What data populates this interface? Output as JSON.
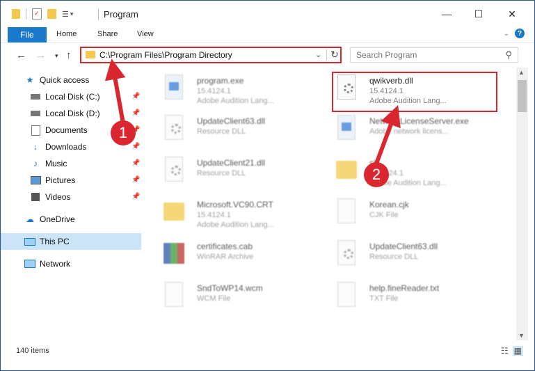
{
  "window": {
    "title": "Program",
    "controls": {
      "minimize": "—",
      "maximize": "☐",
      "close": "✕"
    }
  },
  "ribbon": {
    "tabs": [
      "File",
      "Home",
      "Share",
      "View"
    ],
    "help": "?"
  },
  "address": {
    "path": "C:\\Program Files\\Program Directory",
    "search_placeholder": "Search Program"
  },
  "nav": {
    "items": [
      {
        "label": "Quick access",
        "icon": "star-icon",
        "color": "#1979ca"
      },
      {
        "label": "Local Disk (C:)",
        "icon": "drive-icon",
        "pinned": true
      },
      {
        "label": "Local Disk (D:)",
        "icon": "drive-icon",
        "pinned": true
      },
      {
        "label": "Documents",
        "icon": "documents-icon",
        "pinned": true
      },
      {
        "label": "Downloads",
        "icon": "download-icon",
        "pinned": true
      },
      {
        "label": "Music",
        "icon": "music-icon",
        "pinned": true
      },
      {
        "label": "Pictures",
        "icon": "pictures-icon",
        "pinned": true
      },
      {
        "label": "Videos",
        "icon": "videos-icon",
        "pinned": true
      },
      {
        "label": "OneDrive",
        "icon": "cloud-icon"
      },
      {
        "label": "This PC",
        "icon": "computer-icon",
        "selected": true
      },
      {
        "label": "Network",
        "icon": "network-icon"
      }
    ]
  },
  "files": [
    {
      "name": "program.exe",
      "line1": "15.4124.1",
      "line2": "Adobe Audition Lang...",
      "icon": "exe-icon"
    },
    {
      "name": "qwikverb.dll",
      "line1": "15.4124.1",
      "line2": "Adobe Audition Lang...",
      "icon": "dll-gear-icon",
      "highlighted": true
    },
    {
      "name": "UpdateClient63.dll",
      "line1": "Resource DLL",
      "line2": "",
      "icon": "dll-gear-icon"
    },
    {
      "name": "NetworkLicenseServer.exe",
      "line1": "Adobe network licens...",
      "line2": "",
      "icon": "exe-icon"
    },
    {
      "name": "UpdateClient21.dll",
      "line1": "Resource DLL",
      "line2": "",
      "icon": "dll-gear-icon"
    },
    {
      "name": "sl...",
      "line1": "15.4124.1",
      "line2": "Adobe Audition Lang...",
      "icon": "folder-icon"
    },
    {
      "name": "Microsoft.VC90.CRT",
      "line1": "15.4124.1",
      "line2": "Adobe Audition Lang...",
      "icon": "folder-icon"
    },
    {
      "name": "Korean.cjk",
      "line1": "CJK File",
      "line2": "",
      "icon": "file-icon"
    },
    {
      "name": "certificates.cab",
      "line1": "WinRAR Archive",
      "line2": "",
      "icon": "archive-icon"
    },
    {
      "name": "UpdateClient63.dll",
      "line1": "Resource DLL",
      "line2": "",
      "icon": "dll-gear-icon"
    },
    {
      "name": "SndToWP14.wcm",
      "line1": "WCM File",
      "line2": "",
      "icon": "file-icon"
    },
    {
      "name": "help.fineReader.txt",
      "line1": "TXT File",
      "line2": "",
      "icon": "file-icon"
    }
  ],
  "status": {
    "items": "140 items"
  },
  "callouts": [
    "1",
    "2"
  ],
  "colors": {
    "accent": "#1979ca",
    "highlight": "#d9262f",
    "selected": "#cce4f7"
  }
}
